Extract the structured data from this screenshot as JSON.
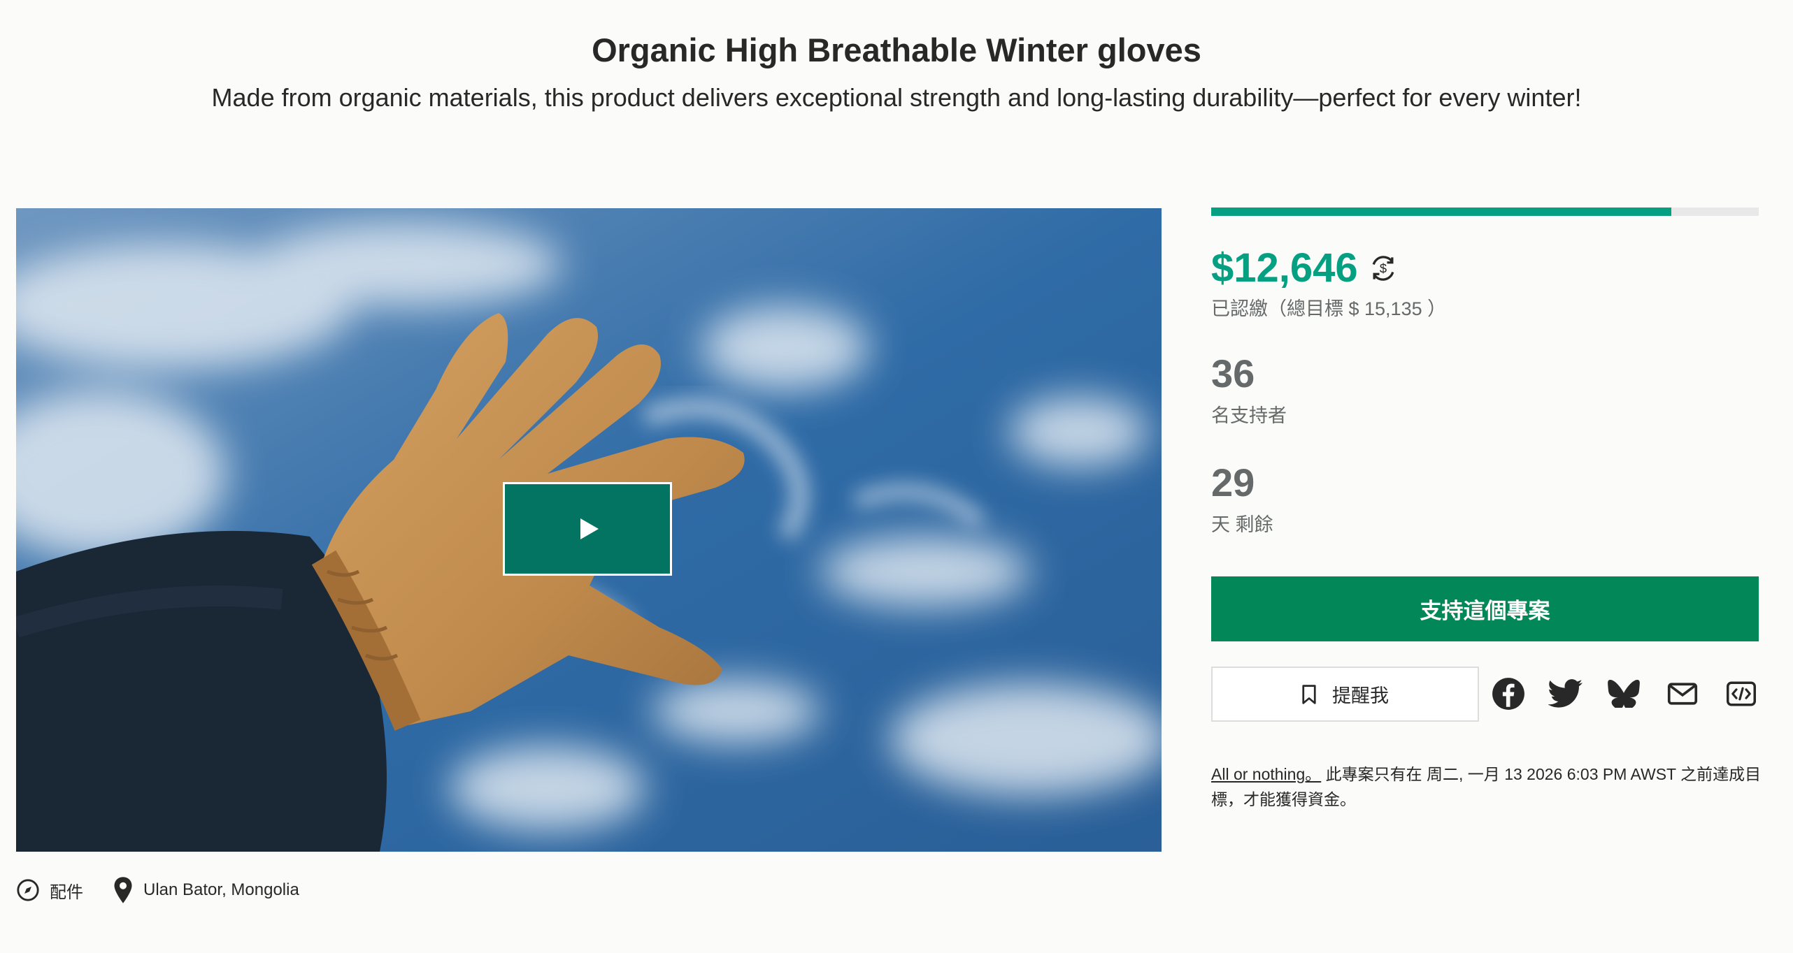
{
  "project": {
    "title": "Organic High Breathable Winter gloves",
    "blurb": "Made from organic materials, this product delivers exceptional strength and long-lasting durability—perfect for every winter!",
    "category": "配件",
    "location": "Ulan Bator, Mongolia"
  },
  "funding": {
    "progress_percent": 84,
    "pledged": "$12,646",
    "pledged_label": "已認繳（總目標 $ 15,135 ）",
    "backers_count": "36",
    "backers_label": "名支持者",
    "days_left": "29",
    "days_label": "天 剩餘"
  },
  "actions": {
    "back_label": "支持這個專案",
    "remind_label": "提醒我"
  },
  "share": [
    "facebook-icon",
    "twitter-icon",
    "bluesky-icon",
    "email-icon",
    "embed-icon"
  ],
  "notice": {
    "link_text": "All or nothing。",
    "text": " 此專案只有在 周二, 一月 13 2026 6:03 PM AWST 之前達成目標，才能獲得資金。"
  },
  "colors": {
    "accent_green": "#05a081",
    "button_green": "#028858",
    "play_button": "#037362"
  }
}
